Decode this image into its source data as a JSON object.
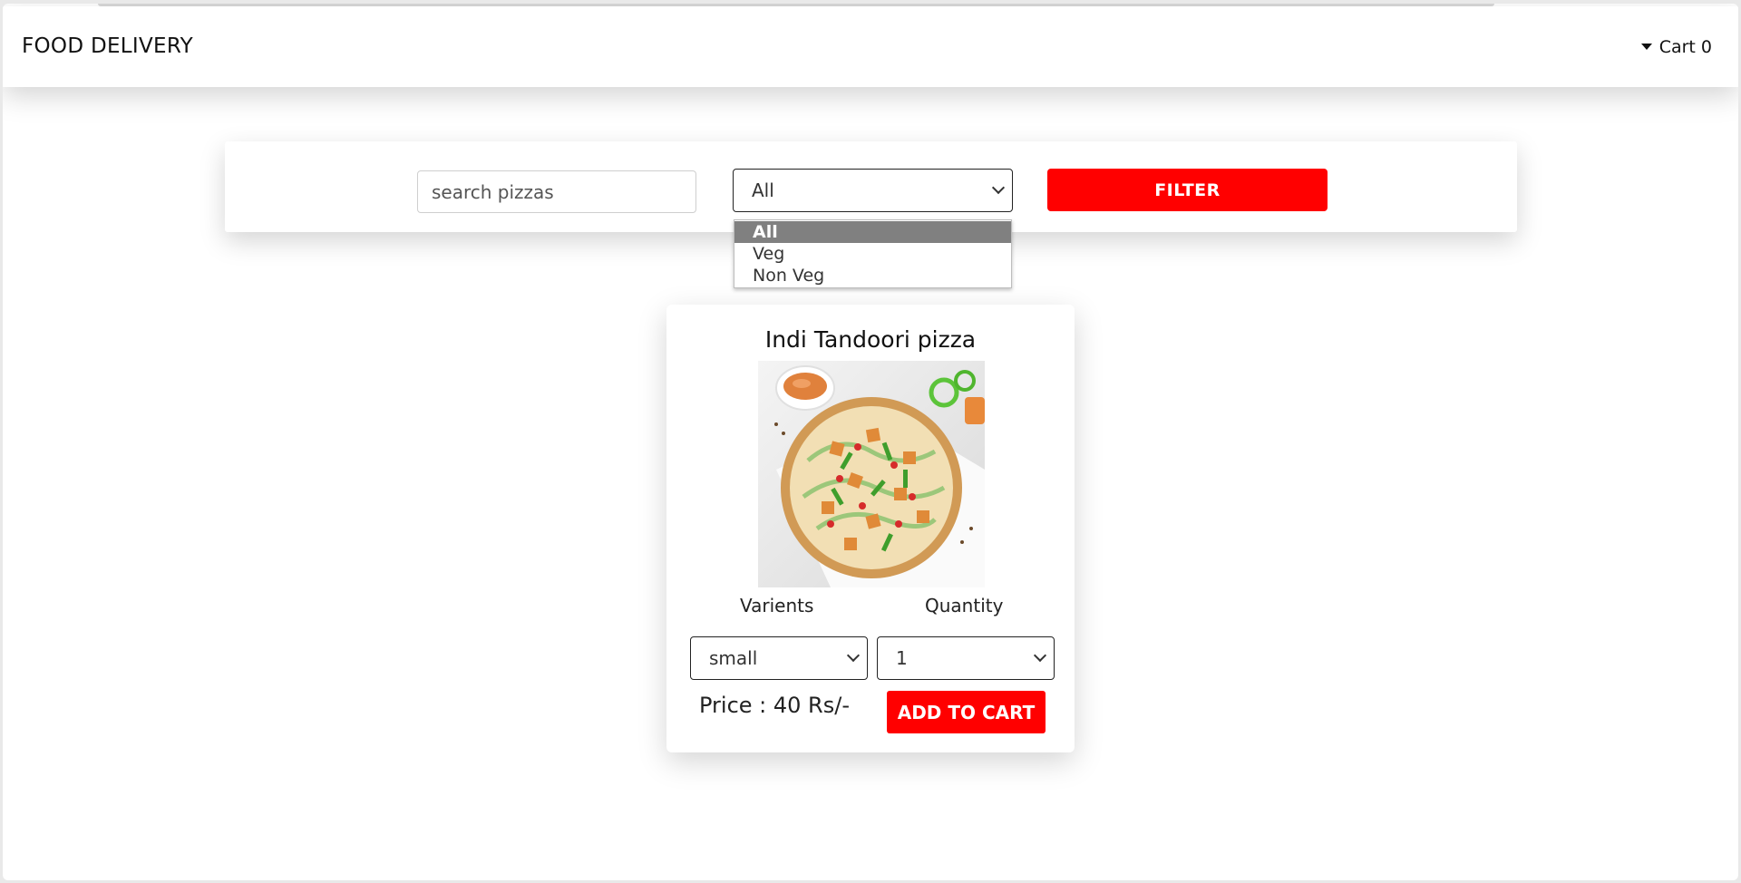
{
  "navbar": {
    "brand": "FOOD DELIVERY",
    "cart_label": "Cart 0"
  },
  "filter": {
    "search_placeholder": "search pizzas",
    "category_selected": "All",
    "category_options": [
      "All",
      "Veg",
      "Non Veg"
    ],
    "filter_label": "FILTER"
  },
  "pizza": {
    "name": "Indi Tandoori pizza",
    "varients_label": "Varients",
    "quantity_label": "Quantity",
    "varient_selected": "small",
    "quantity_selected": "1",
    "price_text": "Price : 40 Rs/-",
    "add_to_cart_label": "ADD TO CART"
  },
  "colors": {
    "accent": "#ff0000",
    "selected_option": "#808080"
  }
}
